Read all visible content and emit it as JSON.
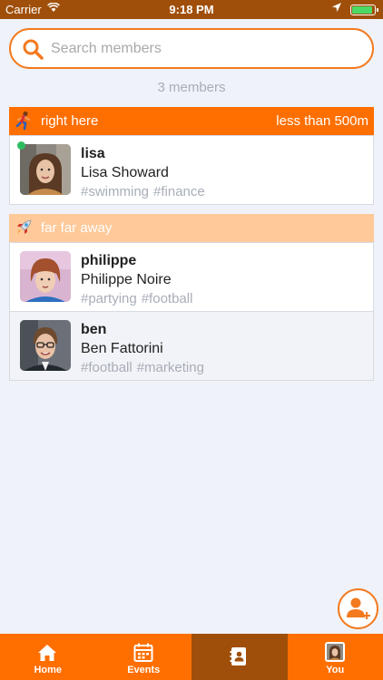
{
  "status_bar": {
    "carrier": "Carrier",
    "time": "9:18 PM",
    "battery_level": 0.9
  },
  "search": {
    "placeholder": "Search members",
    "value": ""
  },
  "member_count": "3 members",
  "groups": [
    {
      "title": "right here",
      "distance": "less than 500m",
      "color": "#ff6f00",
      "icon": "running-person-icon",
      "members": [
        {
          "username": "lisa",
          "full_name": "Lisa Showard",
          "tags": [
            "#swimming",
            "#finance"
          ],
          "online": true,
          "avatar": "avatar-woman-brown-hair"
        }
      ]
    },
    {
      "title": "far far away",
      "distance": "",
      "color": "#ffc99a",
      "icon": "rocket-icon",
      "members": [
        {
          "username": "philippe",
          "full_name": "Philippe Noire",
          "tags": [
            "#partying",
            "#football"
          ],
          "online": false,
          "avatar": "avatar-man-red-hair"
        },
        {
          "username": "ben",
          "full_name": "Ben Fattorini",
          "tags": [
            "#football",
            "#marketing"
          ],
          "online": false,
          "avatar": "avatar-man-glasses"
        }
      ]
    }
  ],
  "tab_bar": {
    "tabs": [
      {
        "label": "Home",
        "icon": "home-icon",
        "active": false
      },
      {
        "label": "Events",
        "icon": "calendar-icon",
        "active": false
      },
      {
        "label": "",
        "icon": "contacts-icon",
        "active": true
      },
      {
        "label": "You",
        "icon": "user-avatar-icon",
        "active": false
      }
    ]
  },
  "colors": {
    "accent": "#ff6f00",
    "accent_dark": "#a04f0a",
    "light_orange": "#ffc99a",
    "online": "#2ebd5e"
  }
}
